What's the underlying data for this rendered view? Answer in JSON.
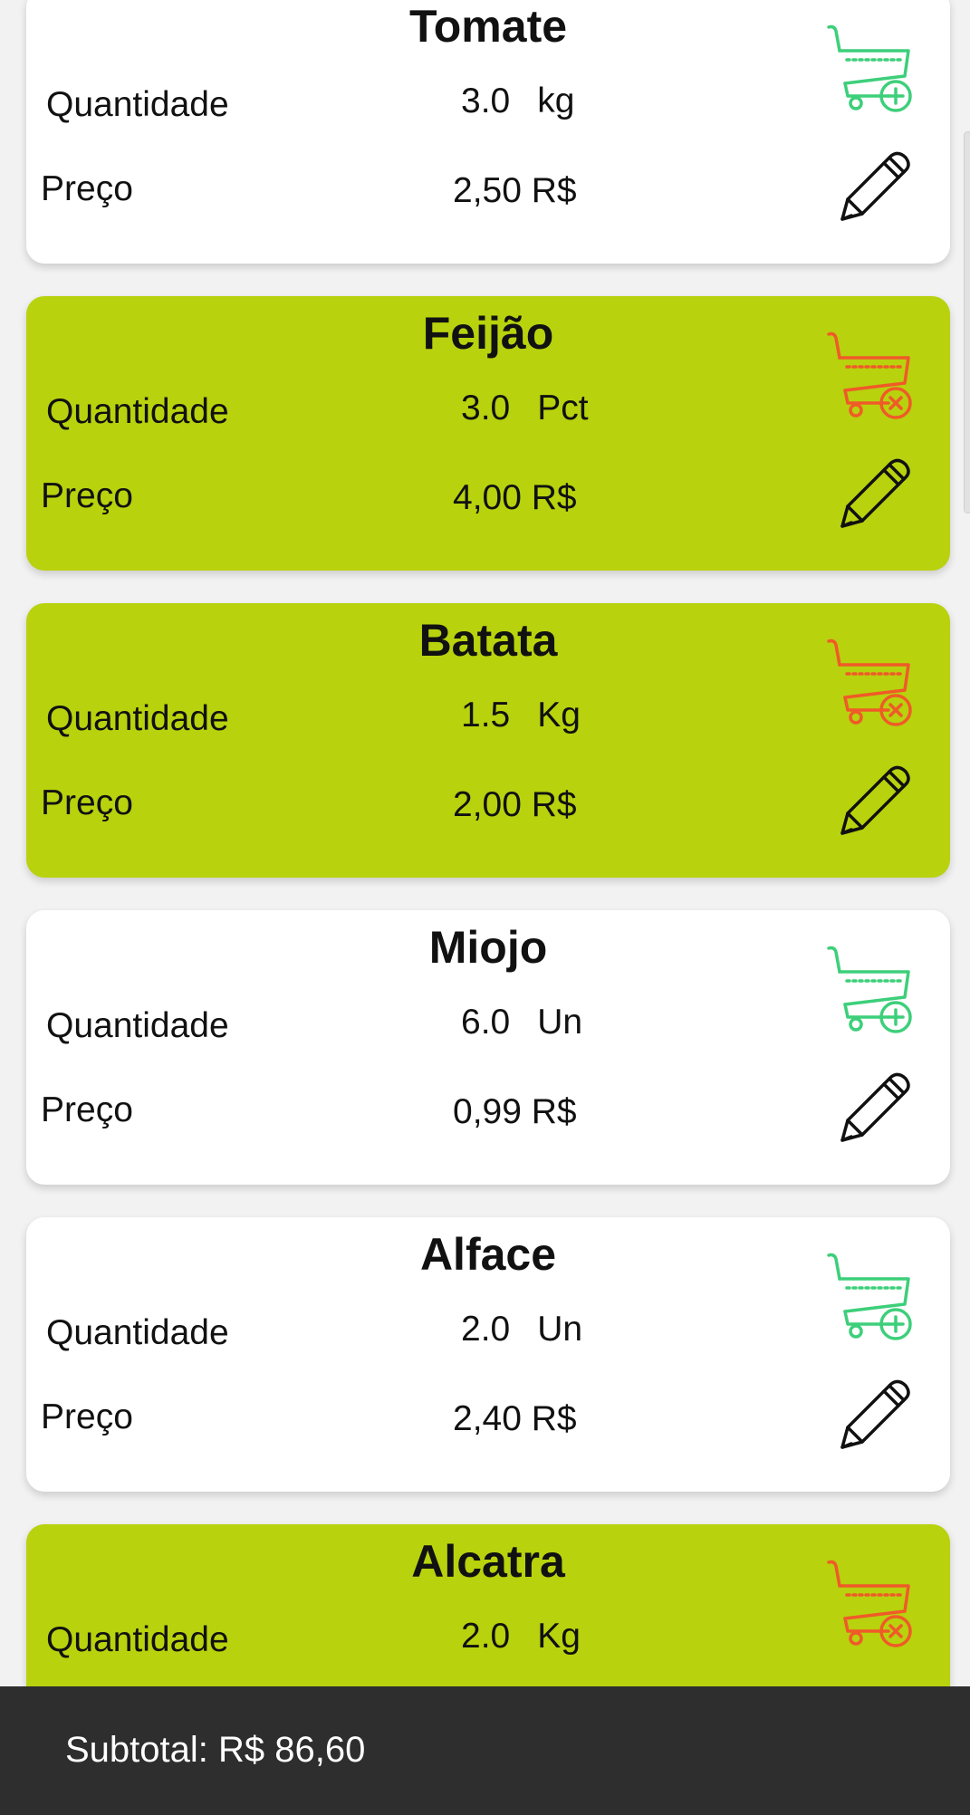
{
  "labels": {
    "quantity": "Quantidade",
    "price": "Preço"
  },
  "colors": {
    "in_cart_card": "#b8d20d",
    "default_card": "#ffffff",
    "add_cart_icon": "#3dcf7a",
    "remove_cart_icon": "#f05a28",
    "footer_bg": "#2e2e2e"
  },
  "products": [
    {
      "name": "Tomate",
      "quantity": "3.0",
      "unit": "kg",
      "price": "2,50 R$",
      "in_cart": false,
      "cart_icon": "cart-add-icon"
    },
    {
      "name": "Feijão",
      "quantity": "3.0",
      "unit": "Pct",
      "price": "4,00 R$",
      "in_cart": true,
      "cart_icon": "cart-remove-icon"
    },
    {
      "name": "Batata",
      "quantity": "1.5",
      "unit": "Kg",
      "price": "2,00 R$",
      "in_cart": true,
      "cart_icon": "cart-remove-icon"
    },
    {
      "name": "Miojo",
      "quantity": "6.0",
      "unit": "Un",
      "price": "0,99 R$",
      "in_cart": false,
      "cart_icon": "cart-add-icon"
    },
    {
      "name": "Alface",
      "quantity": "2.0",
      "unit": "Un",
      "price": "2,40 R$",
      "in_cart": false,
      "cart_icon": "cart-add-icon"
    },
    {
      "name": "Alcatra",
      "quantity": "2.0",
      "unit": "Kg",
      "price": "",
      "in_cart": true,
      "cart_icon": "cart-remove-icon"
    }
  ],
  "footer": {
    "subtotal": "Subtotal: R$ 86,60"
  }
}
